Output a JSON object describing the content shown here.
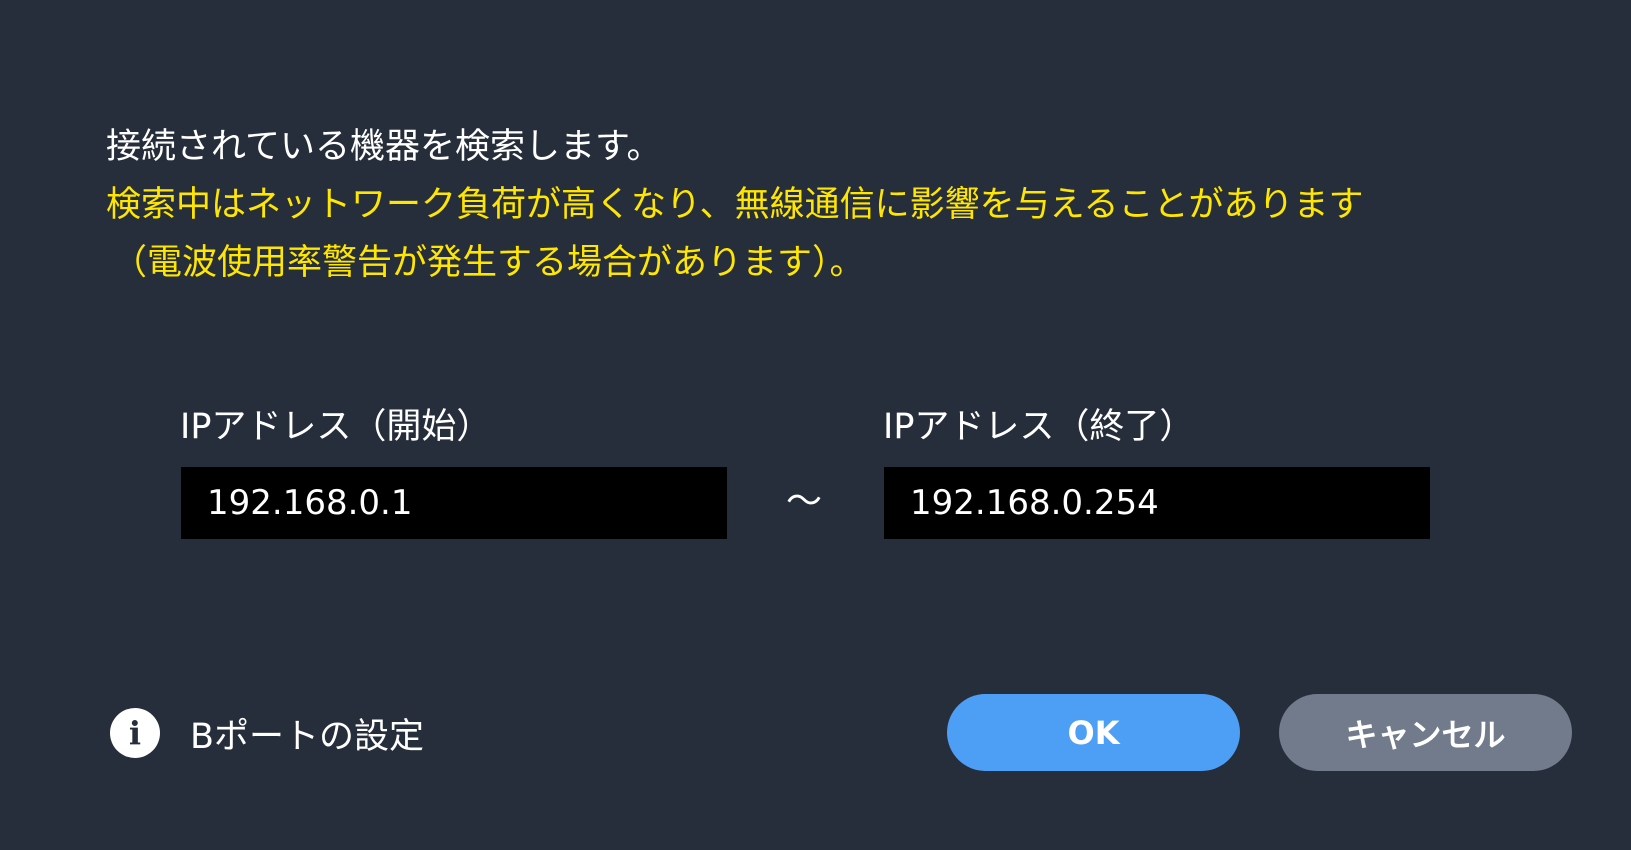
{
  "message": {
    "line1": "接続されている機器を検索します。",
    "warning_line1": "検索中はネットワーク負荷が高くなり、無線通信に影響を与えることがあります",
    "warning_line2": "（電波使用率警告が発生する場合があります）。"
  },
  "ip_range": {
    "start_label": "IPアドレス（開始）",
    "start_value": "192.168.0.1",
    "separator": "～",
    "end_label": "IPアドレス（終了）",
    "end_value": "192.168.0.254"
  },
  "bport": {
    "icon": "info-icon",
    "label": "Bポートの設定"
  },
  "buttons": {
    "ok_label": "OK",
    "cancel_label": "キャンセル"
  },
  "colors": {
    "background": "#262d3b",
    "warning_text": "#ffe600",
    "ok_button": "#4d9ff5",
    "cancel_button": "#717b8c",
    "input_background": "#000000"
  }
}
